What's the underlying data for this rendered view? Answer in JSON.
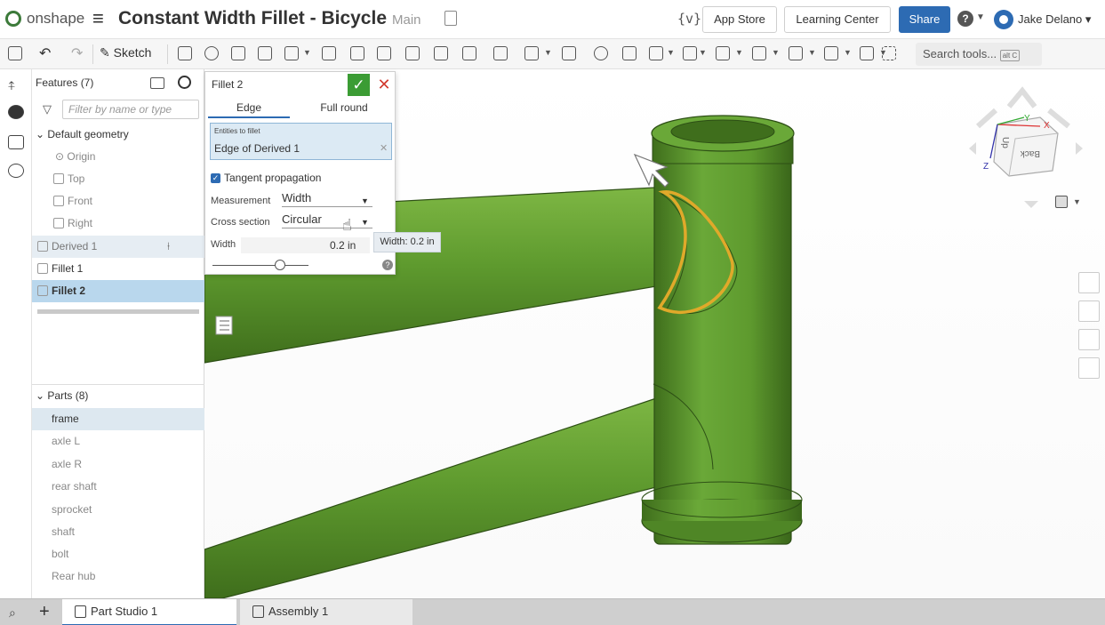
{
  "header": {
    "brand": "onshape",
    "menu_icon": "hamburger-icon",
    "title": "Constant Width Fillet - Bicycle",
    "branch": "Main",
    "variables": "{v}",
    "app_store": "App Store",
    "learning_center": "Learning Center",
    "share": "Share",
    "help": "?",
    "user": "Jake Delano"
  },
  "toolbar": {
    "sketch_label": "Sketch",
    "search_label": "Search tools...",
    "search_shortcut": "alt C"
  },
  "features": {
    "header": "Features (7)",
    "filter_placeholder": "Filter by name or type",
    "default_geometry": "Default geometry",
    "items": [
      "Origin",
      "Top",
      "Front",
      "Right",
      "Derived 1",
      "Fillet 1",
      "Fillet 2"
    ],
    "parts_header": "Parts (8)",
    "parts": [
      "frame",
      "axle L",
      "axle R",
      "rear shaft",
      "sprocket",
      "shaft",
      "bolt",
      "Rear hub"
    ]
  },
  "dialog": {
    "title": "Fillet 2",
    "tab_edge": "Edge",
    "tab_full_round": "Full round",
    "entities_label": "Entities to fillet",
    "entities_value": "Edge of Derived 1",
    "tangent_propagation": "Tangent propagation",
    "measurement_label": "Measurement",
    "measurement_value": "Width",
    "cross_section_label": "Cross section",
    "cross_section_value": "Circular",
    "width_label": "Width",
    "width_value": "0.2 in",
    "tooltip": "Width: 0.2 in"
  },
  "view_cube": {
    "front": "Back",
    "top": "Up",
    "axis_x": "X",
    "axis_y": "Y",
    "axis_z": "Z"
  },
  "tabs": {
    "part_studio": "Part Studio 1",
    "assembly": "Assembly 1"
  },
  "colors": {
    "frame_green": "#5e9a2e",
    "highlight_edge": "#e0a92a",
    "accent_blue": "#2d6bb3",
    "ok_green": "#3b9c34"
  }
}
